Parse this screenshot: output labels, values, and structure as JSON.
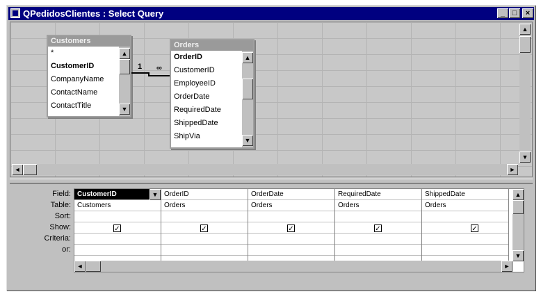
{
  "window": {
    "title": "QPedidosClientes : Select Query",
    "minimize_glyph": "_",
    "maximize_glyph": "□",
    "close_glyph": "×"
  },
  "tables": [
    {
      "name": "Customers",
      "fields": [
        "*",
        "CustomerID",
        "CompanyName",
        "ContactName",
        "ContactTitle"
      ],
      "key_field": "CustomerID"
    },
    {
      "name": "Orders",
      "fields": [
        "OrderID",
        "CustomerID",
        "EmployeeID",
        "OrderDate",
        "RequiredDate",
        "ShippedDate",
        "ShipVia"
      ],
      "key_field": "OrderID"
    }
  ],
  "join": {
    "left_label": "1",
    "right_label": "∞"
  },
  "grid": {
    "row_labels": [
      "Field:",
      "Table:",
      "Sort:",
      "Show:",
      "Criteria:",
      "or:"
    ],
    "columns": [
      {
        "field": "CustomerID",
        "table": "Customers",
        "sort": "",
        "show": true,
        "criteria": "",
        "or": ""
      },
      {
        "field": "OrderID",
        "table": "Orders",
        "sort": "",
        "show": true,
        "criteria": "",
        "or": ""
      },
      {
        "field": "OrderDate",
        "table": "Orders",
        "sort": "",
        "show": true,
        "criteria": "",
        "or": ""
      },
      {
        "field": "RequiredDate",
        "table": "Orders",
        "sort": "",
        "show": true,
        "criteria": "",
        "or": ""
      },
      {
        "field": "ShippedDate",
        "table": "Orders",
        "sort": "",
        "show": true,
        "criteria": "",
        "or": ""
      }
    ],
    "selected_column": 0
  },
  "glyphs": {
    "up": "▲",
    "down": "▼",
    "left": "◄",
    "right": "►",
    "dropdown": "▼",
    "check": "✓"
  },
  "colors": {
    "titlebar": "#000080",
    "face": "#c0c0c0",
    "selected": "#000000"
  }
}
